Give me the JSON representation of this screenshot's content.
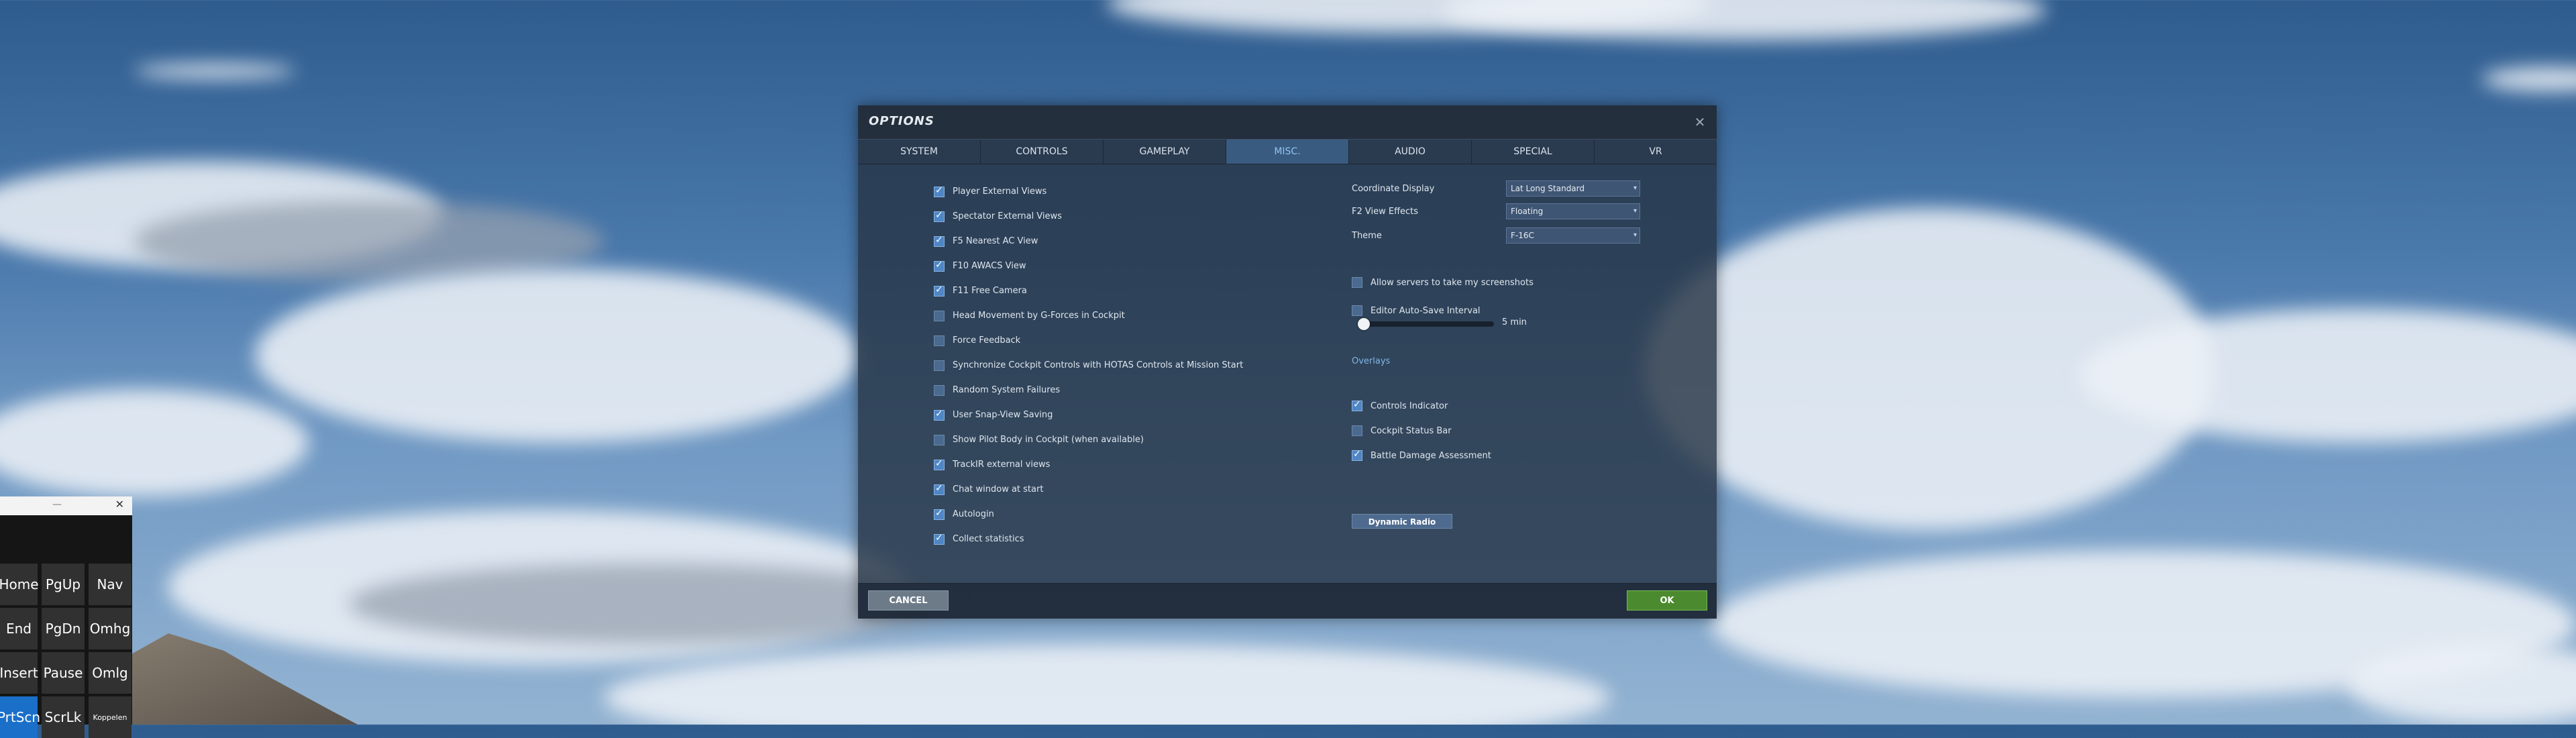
{
  "dialog": {
    "title": "OPTIONS",
    "close_glyph": "✕",
    "tabs": [
      {
        "label": "SYSTEM",
        "active": false
      },
      {
        "label": "CONTROLS",
        "active": false
      },
      {
        "label": "GAMEPLAY",
        "active": false
      },
      {
        "label": "MISC.",
        "active": true
      },
      {
        "label": "AUDIO",
        "active": false
      },
      {
        "label": "SPECIAL",
        "active": false
      },
      {
        "label": "VR",
        "active": false
      }
    ],
    "left_options": [
      {
        "label": "Player External Views",
        "checked": true
      },
      {
        "label": "Spectator External Views",
        "checked": true
      },
      {
        "label": "F5 Nearest AC View",
        "checked": true
      },
      {
        "label": "F10 AWACS View",
        "checked": true
      },
      {
        "label": "F11 Free Camera",
        "checked": true
      },
      {
        "label": "Head Movement by G-Forces in Cockpit",
        "checked": false
      },
      {
        "label": "Force Feedback",
        "checked": false
      },
      {
        "label": "Synchronize Cockpit Controls with HOTAS Controls at Mission Start",
        "checked": false
      },
      {
        "label": "Random System Failures",
        "checked": false
      },
      {
        "label": "User Snap-View Saving",
        "checked": true
      },
      {
        "label": "Show Pilot Body in Cockpit (when available)",
        "checked": false
      },
      {
        "label": "TrackIR external views",
        "checked": true
      },
      {
        "label": "Chat window at start",
        "checked": true
      },
      {
        "label": "Autologin",
        "checked": true
      },
      {
        "label": "Collect statistics",
        "checked": true
      }
    ],
    "selects": [
      {
        "label": "Coordinate Display",
        "value": "Lat Long Standard"
      },
      {
        "label": "F2 View Effects",
        "value": "Floating"
      },
      {
        "label": "Theme",
        "value": "F-16C"
      }
    ],
    "select_chevron": "▾",
    "screenshots": {
      "label": "Allow servers to take my screenshots",
      "checked": false
    },
    "autosave": {
      "label": "Editor Auto-Save Interval",
      "checked": false,
      "value_label": "5 min",
      "level": 0.03
    },
    "overlays_label": "Overlays",
    "overlay_options": [
      {
        "label": "Controls Indicator",
        "checked": true
      },
      {
        "label": "Cockpit Status Bar",
        "checked": false
      },
      {
        "label": "Battle Damage Assessment",
        "checked": true
      }
    ],
    "dynamic_radio_label": "Dynamic Radio",
    "cancel_label": "CANCEL",
    "ok_label": "OK"
  },
  "keyboard": {
    "min_glyph": "—",
    "close_glyph": "✕",
    "keys": [
      {
        "label": "Home",
        "active": false
      },
      {
        "label": "PgUp",
        "active": false
      },
      {
        "label": "Nav",
        "active": false
      },
      {
        "label": "End",
        "active": false
      },
      {
        "label": "PgDn",
        "active": false
      },
      {
        "label": "Omhg",
        "active": false
      },
      {
        "label": "Insert",
        "active": false
      },
      {
        "label": "Pause",
        "active": false
      },
      {
        "label": "Omlg",
        "active": false
      },
      {
        "label": "PrtScn",
        "active": true
      },
      {
        "label": "ScrLk",
        "active": false
      },
      {
        "label": "Koppelen",
        "active": false
      }
    ]
  }
}
